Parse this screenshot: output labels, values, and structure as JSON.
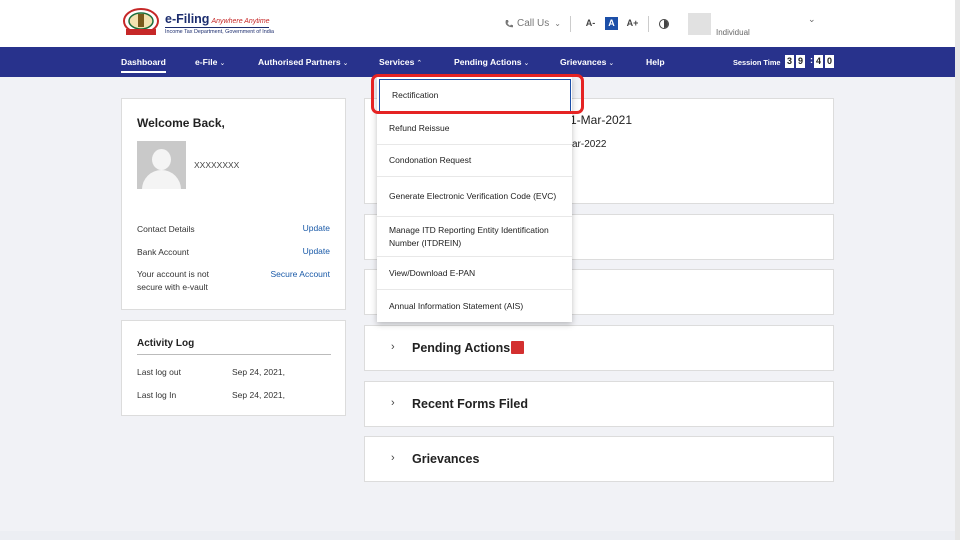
{
  "header": {
    "logo_title": "e-Filing",
    "logo_tagline": "Anywhere Anytime",
    "logo_subtitle": "Income Tax Department, Government of India",
    "call_us": "Call Us",
    "font_decrease": "A-",
    "font_normal": "A",
    "font_increase": "A+",
    "user_type": "Individual"
  },
  "nav": {
    "items": [
      {
        "label": "Dashboard",
        "has_caret": false
      },
      {
        "label": "e-File",
        "has_caret": true
      },
      {
        "label": "Authorised Partners",
        "has_caret": true
      },
      {
        "label": "Services",
        "has_caret": true
      },
      {
        "label": "Pending Actions",
        "has_caret": true
      },
      {
        "label": "Grievances",
        "has_caret": true
      },
      {
        "label": "Help",
        "has_caret": false
      }
    ],
    "session_label": "Session Time",
    "session_digits": [
      "3",
      "9",
      "4",
      "0"
    ]
  },
  "welcome": {
    "title": "Welcome Back,",
    "pan": "XXXXXXXX",
    "rows": [
      {
        "label": "Contact Details",
        "action": "Update"
      },
      {
        "label": "Bank Account",
        "action": "Update"
      },
      {
        "label": "Your account is not secure with e-vault",
        "action": "Secure Account"
      }
    ]
  },
  "activity": {
    "title": "Activity Log",
    "rows": [
      {
        "label": "Last log out",
        "value": "Sep 24, 2021,"
      },
      {
        "label": "Last log In",
        "value": "Sep 24, 2021,"
      }
    ]
  },
  "right_panel": {
    "partial_date_1": "1-Mar-2021",
    "partial_date_2": "ar-2022",
    "sections": [
      "Pending Actions",
      "Recent Forms Filed",
      "Grievances"
    ]
  },
  "services_menu": {
    "items": [
      "Rectification",
      "Refund Reissue",
      "Condonation Request",
      "Generate Electronic Verification Code (EVC)",
      "Manage ITD Reporting Entity Identification Number (ITDREIN)",
      "View/Download E-PAN",
      "Annual Information Statement (AIS)"
    ],
    "highlighted": "Rectification"
  },
  "colors": {
    "nav_bg": "#28328c",
    "link": "#1a5aa8",
    "highlight_ring": "#e52323",
    "badge": "#d32f2f"
  }
}
